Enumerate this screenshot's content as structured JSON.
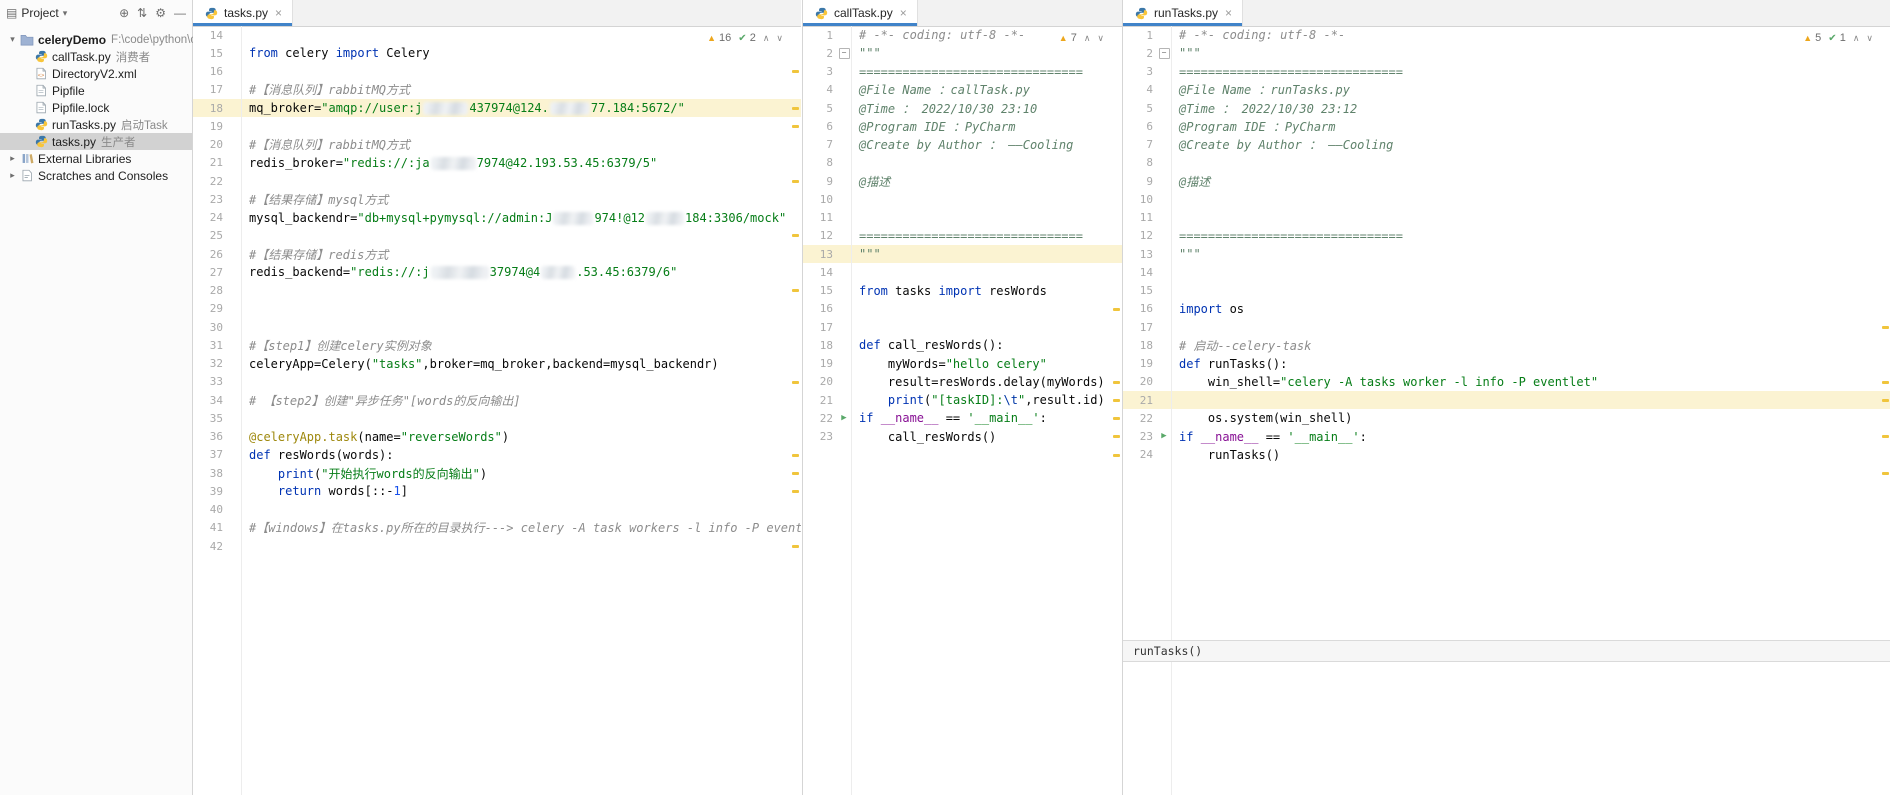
{
  "icons": {
    "project_tool": "▤",
    "dropdown": "▾",
    "locate": "⊕",
    "collapse_all": "⇅",
    "settings": "⚙",
    "hide": "—",
    "close": "×",
    "run": "▶",
    "warning": "▲",
    "check": "✔",
    "chev_up": "∧",
    "chev_down": "∨"
  },
  "project_panel": {
    "title": "Project",
    "tree": [
      {
        "id": "celerydemo",
        "label": "celeryDemo",
        "annotation": "F:\\code\\python\\ce",
        "icon": "folder-icon",
        "expanded": true,
        "bold": true,
        "indent": 0
      },
      {
        "id": "calltask-py",
        "label": "callTask.py",
        "annotation": "消费者",
        "icon": "python-icon",
        "indent": 1
      },
      {
        "id": "directoryv2-xml",
        "label": "DirectoryV2.xml",
        "icon": "xml-icon",
        "indent": 1
      },
      {
        "id": "pipfile",
        "label": "Pipfile",
        "icon": "file-icon",
        "indent": 1
      },
      {
        "id": "pipfile-lock",
        "label": "Pipfile.lock",
        "icon": "file-icon",
        "indent": 1
      },
      {
        "id": "runtasks-py",
        "label": "runTasks.py",
        "annotation": "启动Task",
        "icon": "python-icon",
        "indent": 1
      },
      {
        "id": "tasks-py",
        "label": "tasks.py",
        "annotation": "生产者",
        "icon": "python-icon",
        "indent": 1,
        "selected": true
      },
      {
        "id": "external-libraries",
        "label": "External Libraries",
        "icon": "lib-icon",
        "expanded": false,
        "indent": 0
      },
      {
        "id": "scratches",
        "label": "Scratches and Consoles",
        "icon": "scratch-icon",
        "expanded": false,
        "indent": 0
      }
    ]
  },
  "editors": [
    {
      "tab": "tasks.py",
      "inspections": {
        "warnings": "16",
        "ok": "2"
      },
      "scroll_marks": [
        18,
        55,
        73,
        128,
        182,
        237,
        329,
        402,
        420,
        438,
        493
      ],
      "lines": [
        {
          "n": 14,
          "tk": []
        },
        {
          "n": 15,
          "tk": [
            [
              "kw",
              "from"
            ],
            [
              "pl",
              " celery "
            ],
            [
              "kw",
              "import"
            ],
            [
              "pl",
              " Celery"
            ]
          ]
        },
        {
          "n": 16,
          "tk": []
        },
        {
          "n": 17,
          "tk": [
            [
              "com",
              "#【消息队列】rabbitMQ方式"
            ]
          ]
        },
        {
          "n": 18,
          "hl": true,
          "tk": [
            [
              "pl",
              "mq_broker="
            ],
            [
              "str",
              "\"amqp://user:j"
            ],
            [
              "blur",
              45
            ],
            [
              "str",
              "437974@124."
            ],
            [
              "blur",
              40
            ],
            [
              "str",
              "77.184:5672/\""
            ]
          ]
        },
        {
          "n": 19,
          "tk": []
        },
        {
          "n": 20,
          "tk": [
            [
              "com",
              "#【消息队列】rabbitMQ方式"
            ]
          ]
        },
        {
          "n": 21,
          "tk": [
            [
              "pl",
              "redis_broker="
            ],
            [
              "str",
              "\"redis://:ja"
            ],
            [
              "blur",
              45
            ],
            [
              "str",
              "7974@42.193.53.45:6379/5\""
            ]
          ]
        },
        {
          "n": 22,
          "tk": []
        },
        {
          "n": 23,
          "tk": [
            [
              "com",
              "#【结果存储】mysql方式"
            ]
          ]
        },
        {
          "n": 24,
          "tk": [
            [
              "pl",
              "mysql_backendr="
            ],
            [
              "str",
              "\"db+mysql+pymysql://admin:J"
            ],
            [
              "blur",
              40
            ],
            [
              "str",
              "974!@12"
            ],
            [
              "blur",
              38
            ],
            [
              "str",
              "184:3306/mock\""
            ]
          ]
        },
        {
          "n": 25,
          "tk": []
        },
        {
          "n": 26,
          "tk": [
            [
              "com",
              "#【结果存储】redis方式"
            ]
          ]
        },
        {
          "n": 27,
          "tk": [
            [
              "pl",
              "redis_backend="
            ],
            [
              "str",
              "\"redis://:j"
            ],
            [
              "blur",
              58
            ],
            [
              "str",
              "37974@4"
            ],
            [
              "blur",
              34
            ],
            [
              "str",
              ".53.45:6379/6\""
            ]
          ]
        },
        {
          "n": 28,
          "tk": []
        },
        {
          "n": 29,
          "tk": []
        },
        {
          "n": 30,
          "tk": []
        },
        {
          "n": 31,
          "tk": [
            [
              "com",
              "#【step1】创建celery实例对象"
            ]
          ]
        },
        {
          "n": 32,
          "tk": [
            [
              "pl",
              "celeryApp=Celery("
            ],
            [
              "str",
              "\"tasks\""
            ],
            [
              "pl",
              ",broker=mq_broker,backend=mysql_backendr)"
            ]
          ]
        },
        {
          "n": 33,
          "tk": []
        },
        {
          "n": 34,
          "tk": [
            [
              "com",
              "# 【step2】创建\"异步任务\"[words的反向输出]"
            ]
          ]
        },
        {
          "n": 35,
          "tk": []
        },
        {
          "n": 36,
          "tk": [
            [
              "dec",
              "@celeryApp.task"
            ],
            [
              "pl",
              "(name="
            ],
            [
              "str",
              "\"reverseWords\""
            ],
            [
              "pl",
              ")"
            ]
          ]
        },
        {
          "n": 37,
          "tk": [
            [
              "kw",
              "def"
            ],
            [
              "pl",
              " resWords(words):"
            ]
          ]
        },
        {
          "n": 38,
          "tk": [
            [
              "pl",
              "    "
            ],
            [
              "kw",
              "print"
            ],
            [
              "pl",
              "("
            ],
            [
              "str",
              "\"开始执行words的反向输出\""
            ],
            [
              "pl",
              ")"
            ]
          ]
        },
        {
          "n": 39,
          "tk": [
            [
              "pl",
              "    "
            ],
            [
              "kw",
              "return"
            ],
            [
              "pl",
              " words[::-"
            ],
            [
              "num",
              "1"
            ],
            [
              "pl",
              "]"
            ]
          ]
        },
        {
          "n": 40,
          "tk": []
        },
        {
          "n": 41,
          "tk": [
            [
              "com",
              "#【windows】在tasks.py所在的目录执行---> celery -A task workers -l info -P eventlet"
            ]
          ]
        },
        {
          "n": 42,
          "tk": []
        }
      ]
    },
    {
      "tab": "callTask.py",
      "inspections": {
        "warnings": "7"
      },
      "scroll_marks": [
        256,
        329,
        347,
        365,
        383,
        402
      ],
      "lines": [
        {
          "n": 1,
          "tk": [
            [
              "com",
              "# -*- coding: utf-8 -*-"
            ]
          ]
        },
        {
          "n": 2,
          "fold": "-",
          "tk": [
            [
              "doc",
              "\"\"\""
            ]
          ]
        },
        {
          "n": 3,
          "tk": [
            [
              "doc",
              "==============================="
            ]
          ]
        },
        {
          "n": 4,
          "tk": [
            [
              "doc",
              "@File Name ：callTask.py"
            ]
          ]
        },
        {
          "n": 5,
          "tk": [
            [
              "doc",
              "@Time ： 2022/10/30 23:10"
            ]
          ]
        },
        {
          "n": 6,
          "tk": [
            [
              "doc",
              "@Program IDE ：PyCharm"
            ]
          ]
        },
        {
          "n": 7,
          "tk": [
            [
              "doc",
              "@Create by Author ： ——Cooling"
            ]
          ]
        },
        {
          "n": 8,
          "tk": []
        },
        {
          "n": 9,
          "tk": [
            [
              "doc",
              "@描述"
            ]
          ]
        },
        {
          "n": 10,
          "tk": []
        },
        {
          "n": 11,
          "tk": []
        },
        {
          "n": 12,
          "tk": [
            [
              "doc",
              "==============================="
            ]
          ]
        },
        {
          "n": 13,
          "hl": true,
          "tk": [
            [
              "doc",
              "\"\"\""
            ]
          ]
        },
        {
          "n": 14,
          "tk": []
        },
        {
          "n": 15,
          "tk": [
            [
              "kw",
              "from"
            ],
            [
              "pl",
              " tasks "
            ],
            [
              "kw",
              "import"
            ],
            [
              "pl",
              " resWords"
            ]
          ]
        },
        {
          "n": 16,
          "tk": []
        },
        {
          "n": 17,
          "tk": []
        },
        {
          "n": 18,
          "tk": [
            [
              "kw",
              "def"
            ],
            [
              "pl",
              " call_resWords():"
            ]
          ]
        },
        {
          "n": 19,
          "tk": [
            [
              "pl",
              "    myWords="
            ],
            [
              "str",
              "\"hello celery\""
            ]
          ]
        },
        {
          "n": 20,
          "tk": [
            [
              "pl",
              "    result=resWords.delay(myWords)"
            ]
          ]
        },
        {
          "n": 21,
          "tk": [
            [
              "pl",
              "    "
            ],
            [
              "kw",
              "print"
            ],
            [
              "pl",
              "("
            ],
            [
              "str",
              "\"[taskID]:"
            ],
            [
              "esc",
              "\\t"
            ],
            [
              "str",
              "\""
            ],
            [
              "pl",
              ",result.id)"
            ]
          ]
        },
        {
          "n": 22,
          "run": true,
          "tk": [
            [
              "kw",
              "if"
            ],
            [
              "pl",
              " "
            ],
            [
              "dunder",
              "__name__"
            ],
            [
              "pl",
              " == "
            ],
            [
              "str",
              "'__main__'"
            ],
            [
              "pl",
              ":"
            ]
          ]
        },
        {
          "n": 23,
          "tk": [
            [
              "pl",
              "    call_resWords()"
            ]
          ]
        }
      ]
    },
    {
      "tab": "runTasks.py",
      "inspections": {
        "warnings": "5",
        "ok": "1"
      },
      "scroll_marks": [
        274,
        329,
        347,
        383,
        420
      ],
      "breadcrumb": "runTasks()",
      "lines": [
        {
          "n": 1,
          "tk": [
            [
              "com",
              "# -*- coding: utf-8 -*-"
            ]
          ]
        },
        {
          "n": 2,
          "fold": "-",
          "tk": [
            [
              "doc",
              "\"\"\""
            ]
          ]
        },
        {
          "n": 3,
          "tk": [
            [
              "doc",
              "==============================="
            ]
          ]
        },
        {
          "n": 4,
          "tk": [
            [
              "doc",
              "@File Name ：runTasks.py"
            ]
          ]
        },
        {
          "n": 5,
          "tk": [
            [
              "doc",
              "@Time ： 2022/10/30 23:12"
            ]
          ]
        },
        {
          "n": 6,
          "tk": [
            [
              "doc",
              "@Program IDE ：PyCharm"
            ]
          ]
        },
        {
          "n": 7,
          "tk": [
            [
              "doc",
              "@Create by Author ： ——Cooling"
            ]
          ]
        },
        {
          "n": 8,
          "tk": []
        },
        {
          "n": 9,
          "tk": [
            [
              "doc",
              "@描述"
            ]
          ]
        },
        {
          "n": 10,
          "tk": []
        },
        {
          "n": 11,
          "tk": []
        },
        {
          "n": 12,
          "tk": [
            [
              "doc",
              "==============================="
            ]
          ]
        },
        {
          "n": 13,
          "tk": [
            [
              "doc",
              "\"\"\""
            ]
          ]
        },
        {
          "n": 14,
          "tk": []
        },
        {
          "n": 15,
          "tk": []
        },
        {
          "n": 16,
          "tk": [
            [
              "kw",
              "import"
            ],
            [
              "pl",
              " os"
            ]
          ]
        },
        {
          "n": 17,
          "tk": []
        },
        {
          "n": 18,
          "tk": [
            [
              "com",
              "# 启动--celery-task"
            ]
          ]
        },
        {
          "n": 19,
          "tk": [
            [
              "kw",
              "def"
            ],
            [
              "pl",
              " runTasks():"
            ]
          ]
        },
        {
          "n": 20,
          "tk": [
            [
              "pl",
              "    win_shell="
            ],
            [
              "str",
              "\"celery -A tasks worker -l info -P eventlet\""
            ]
          ]
        },
        {
          "n": 21,
          "hl": true,
          "tk": []
        },
        {
          "n": 22,
          "tk": [
            [
              "pl",
              "    os.system(win_shell)"
            ]
          ]
        },
        {
          "n": 23,
          "run": true,
          "tk": [
            [
              "kw",
              "if"
            ],
            [
              "pl",
              " "
            ],
            [
              "dunder",
              "__name__"
            ],
            [
              "pl",
              " == "
            ],
            [
              "str",
              "'__main__'"
            ],
            [
              "pl",
              ":"
            ]
          ]
        },
        {
          "n": 24,
          "tk": [
            [
              "pl",
              "    runTasks()"
            ]
          ]
        }
      ]
    }
  ]
}
